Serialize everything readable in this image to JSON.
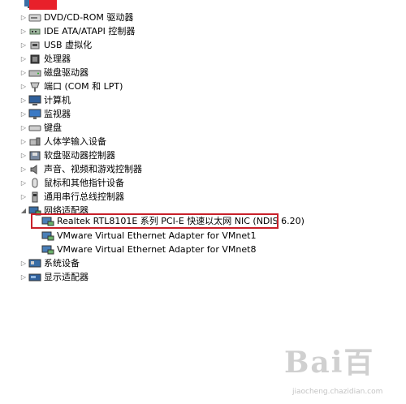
{
  "tree": {
    "expand_collapsed_glyph": "▷",
    "expand_open_glyph": "◢",
    "items": [
      {
        "label": "DVD/CD-ROM 驱动器",
        "icon": "dvd-drive-icon"
      },
      {
        "label": "IDE ATA/ATAPI 控制器",
        "icon": "ide-controller-icon"
      },
      {
        "label": "USB 虚拟化",
        "icon": "usb-icon"
      },
      {
        "label": "处理器",
        "icon": "processor-icon"
      },
      {
        "label": "磁盘驱动器",
        "icon": "disk-drive-icon"
      },
      {
        "label": "端口 (COM 和 LPT)",
        "icon": "port-icon"
      },
      {
        "label": "计算机",
        "icon": "computer-icon"
      },
      {
        "label": "监视器",
        "icon": "monitor-icon"
      },
      {
        "label": "键盘",
        "icon": "keyboard-icon"
      },
      {
        "label": "人体学输入设备",
        "icon": "hid-icon"
      },
      {
        "label": "软盘驱动器控制器",
        "icon": "floppy-controller-icon"
      },
      {
        "label": "声音、视频和游戏控制器",
        "icon": "sound-icon"
      },
      {
        "label": "鼠标和其他指针设备",
        "icon": "mouse-icon"
      },
      {
        "label": "通用串行总线控制器",
        "icon": "usb-controller-icon"
      },
      {
        "label": "网络适配器",
        "icon": "network-adapter-icon"
      },
      {
        "label": "系统设备",
        "icon": "system-device-icon"
      },
      {
        "label": "显示适配器",
        "icon": "display-adapter-icon"
      }
    ],
    "network_children": [
      {
        "label": "Realtek RTL8101E 系列 PCI-E 快速以太网 NIC (NDIS 6.20)",
        "icon": "network-card-icon"
      },
      {
        "label": "VMware Virtual Ethernet Adapter for VMnet1",
        "icon": "network-card-icon"
      },
      {
        "label": "VMware Virtual Ethernet Adapter for VMnet8",
        "icon": "network-card-icon"
      }
    ]
  },
  "colors": {
    "highlight_border": "#c8202a",
    "root_red": "#e8202a"
  },
  "watermark": {
    "main": "Bai百",
    "sub": "jiaocheng.chazidian.com"
  }
}
